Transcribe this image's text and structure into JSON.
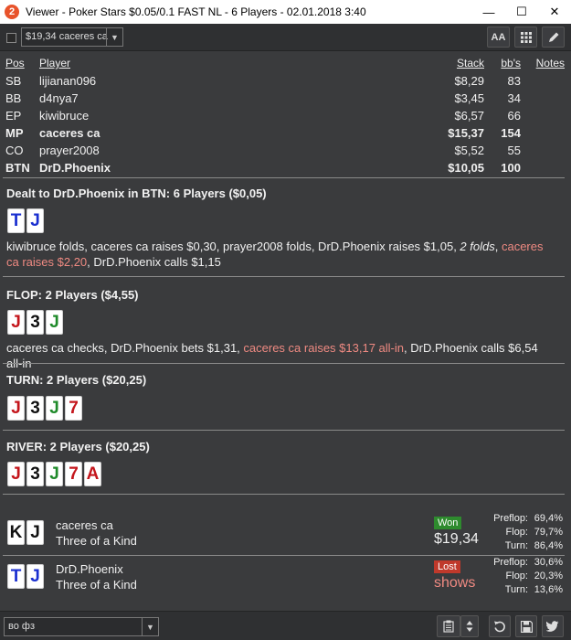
{
  "window": {
    "app_icon": "2",
    "title": "Viewer - Poker Stars $0.05/0.1 FAST NL - 6 Players - 02.01.2018 3:40",
    "minimize": "—",
    "maximize": "☐",
    "close": "✕"
  },
  "toolbar": {
    "hand_select_value": "$19,34 caceres ca",
    "font_button": "AA"
  },
  "players": {
    "headers": {
      "pos": "Pos",
      "player": "Player",
      "stack": "Stack",
      "bbs": "bb's",
      "notes": "Notes"
    },
    "rows": [
      {
        "pos": "SB",
        "player": "lijianan096",
        "stack": "$8,29",
        "bbs": "83",
        "bold": false
      },
      {
        "pos": "BB",
        "player": "d4nya7",
        "stack": "$3,45",
        "bbs": "34",
        "bold": false
      },
      {
        "pos": "EP",
        "player": "kiwibruce",
        "stack": "$6,57",
        "bbs": "66",
        "bold": false
      },
      {
        "pos": "MP",
        "player": "caceres ca",
        "stack": "$15,37",
        "bbs": "154",
        "bold": true
      },
      {
        "pos": "CO",
        "player": "prayer2008",
        "stack": "$5,52",
        "bbs": "55",
        "bold": false
      },
      {
        "pos": "BTN",
        "player": "DrD.Phoenix",
        "stack": "$10,05",
        "bbs": "100",
        "bold": true
      }
    ]
  },
  "preflop": {
    "header": "Dealt to DrD.Phoenix in BTN: 6 Players ($0,05)",
    "cards": [
      {
        "rank": "T",
        "color": "#1a2fd0"
      },
      {
        "rank": "J",
        "color": "#1a2fd0"
      }
    ],
    "action_1": "kiwibruce folds, caceres ca raises $0,30, prayer2008 folds, DrD.Phoenix raises $1,05, ",
    "action_2_italic": "2 folds",
    "action_3": ", ",
    "action_4_red": "caceres ca raises $2,20",
    "action_5": ", DrD.Phoenix calls $1,15"
  },
  "flop": {
    "header": "FLOP: 2 Players ($4,55)",
    "cards": [
      {
        "rank": "J",
        "color": "#c4161c"
      },
      {
        "rank": "3",
        "color": "#111111"
      },
      {
        "rank": "J",
        "color": "#1f8a2a"
      }
    ],
    "action_1": "caceres ca checks, DrD.Phoenix bets $1,31, ",
    "action_2_red": "caceres ca raises $13,17 all-in",
    "action_3": ", DrD.Phoenix calls $6,54 all-in"
  },
  "turn": {
    "header": "TURN: 2 Players ($20,25)",
    "cards": [
      {
        "rank": "J",
        "color": "#c4161c"
      },
      {
        "rank": "3",
        "color": "#111111"
      },
      {
        "rank": "J",
        "color": "#1f8a2a"
      },
      {
        "rank": "7",
        "color": "#c4161c"
      }
    ]
  },
  "river": {
    "header": "RIVER: 2 Players ($20,25)",
    "cards": [
      {
        "rank": "J",
        "color": "#c4161c"
      },
      {
        "rank": "3",
        "color": "#111111"
      },
      {
        "rank": "J",
        "color": "#1f8a2a"
      },
      {
        "rank": "7",
        "color": "#c4161c"
      },
      {
        "rank": "A",
        "color": "#c4161c"
      }
    ]
  },
  "results": [
    {
      "player": "caceres ca",
      "hand": "Three of a Kind",
      "cards": [
        {
          "rank": "K",
          "color": "#111111"
        },
        {
          "rank": "J",
          "color": "#111111"
        }
      ],
      "badge": "Won",
      "amount": "$19,34",
      "stats": [
        {
          "label": "Preflop:",
          "value": "69,4%"
        },
        {
          "label": "Flop:",
          "value": "79,7%"
        },
        {
          "label": "Turn:",
          "value": "86,4%"
        }
      ]
    },
    {
      "player": "DrD.Phoenix",
      "hand": "Three of a Kind",
      "cards": [
        {
          "rank": "T",
          "color": "#1a2fd0"
        },
        {
          "rank": "J",
          "color": "#1a2fd0"
        }
      ],
      "badge": "Lost",
      "amount": "shows",
      "stats": [
        {
          "label": "Preflop:",
          "value": "30,6%"
        },
        {
          "label": "Flop:",
          "value": "20,3%"
        },
        {
          "label": "Turn:",
          "value": "13,6%"
        }
      ]
    }
  ],
  "bottom": {
    "note_select_value": "во фз"
  },
  "colors": {
    "background": "#3a3b3d",
    "red_action": "#ef8a82",
    "won": "#2e8b2e",
    "lost": "#c0392b",
    "lost_amount": "#ef8a82"
  }
}
